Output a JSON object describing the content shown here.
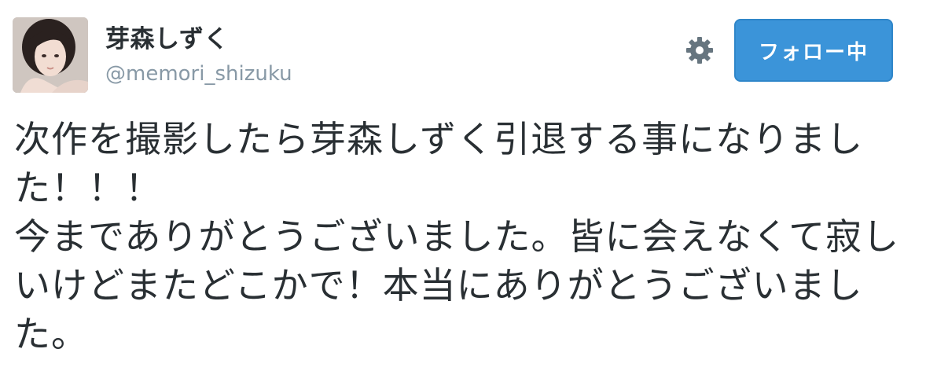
{
  "user": {
    "display_name": "芽森しずく",
    "screen_name": "@memori_shizuku",
    "avatar_icon": "user-avatar-photo"
  },
  "actions": {
    "settings_icon": "gear-icon",
    "follow_label": "フォロー中",
    "follow_color": "#3b94d9"
  },
  "tweet": {
    "text": "次作を撮影したら芽森しずく引退する事になりました！！！\n今までありがとうございました。皆に会えなくて寂しいけどまたどこかで！本当にありがとうございました。"
  },
  "colors": {
    "text_primary": "#292f33",
    "text_secondary": "#8899a6",
    "icon": "#66757f"
  }
}
